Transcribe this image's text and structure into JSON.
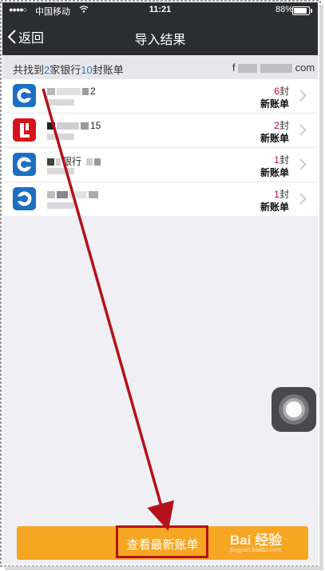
{
  "status_bar": {
    "signal": "●●●●○",
    "carrier": "中国移动",
    "time": "11:21",
    "battery": "88%"
  },
  "nav": {
    "back_label": "返回",
    "title": "导入结果"
  },
  "summary": {
    "prefix": "共找到",
    "bank_count": "2",
    "middle": "家银行",
    "bill_count": "10",
    "suffix": "封账单",
    "email_start": "f",
    "email_end": "com"
  },
  "bills": [
    {
      "icon": "ccb-bank-icon",
      "name_tail": "2",
      "count": "6",
      "unit": "封",
      "status": "新账单"
    },
    {
      "icon": "red-bank-icon",
      "name_tail": "15",
      "count": "2",
      "unit": "封",
      "status": "新账单"
    },
    {
      "icon": "ccb-bank-icon",
      "name_tail": "银行",
      "count": "1",
      "unit": "封",
      "status": "新账单"
    },
    {
      "icon": "ccb-bank-icon",
      "name_tail": "",
      "count": "1",
      "unit": "封",
      "status": "新账单"
    }
  ],
  "button": {
    "label": "查看最新账单"
  },
  "watermark": {
    "text": "Bai 经验",
    "url": "jingyan.baidu.com"
  },
  "colors": {
    "accent_button": "#f5a623",
    "nav_bg": "#2b2d30",
    "count_red": "#d0021b",
    "highlight_red": "#b3121a"
  }
}
